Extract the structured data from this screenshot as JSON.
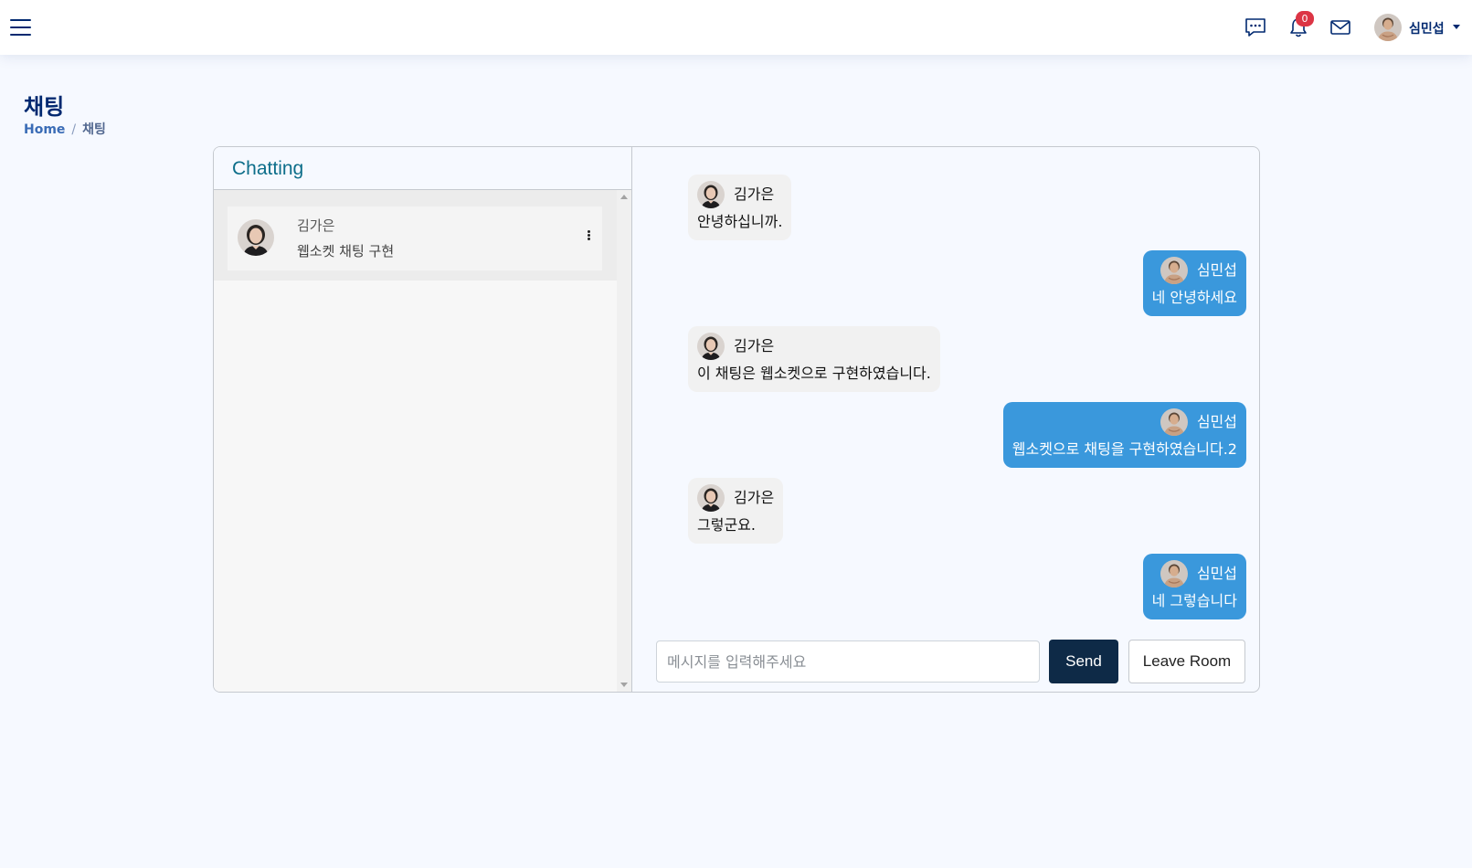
{
  "header": {
    "notification_count": "0",
    "user_name": "심민섭"
  },
  "page": {
    "title": "채팅",
    "breadcrumb": {
      "home": "Home",
      "separator": "/",
      "current": "채팅"
    }
  },
  "chat": {
    "panel_title": "Chatting",
    "rooms": [
      {
        "name": "김가은",
        "last_message": "웹소켓 채팅 구현"
      }
    ],
    "messages": [
      {
        "sender": "김가은",
        "text": "안녕하십니까.",
        "direction": "in"
      },
      {
        "sender": "심민섭",
        "text": "네 안녕하세요",
        "direction": "out"
      },
      {
        "sender": "김가은",
        "text": "이 채팅은 웹소켓으로 구현하였습니다.",
        "direction": "in"
      },
      {
        "sender": "심민섭",
        "text": "웹소켓으로 채팅을 구현하였습니다.2",
        "direction": "out"
      },
      {
        "sender": "김가은",
        "text": "그렇군요.",
        "direction": "in"
      },
      {
        "sender": "심민섭",
        "text": "네 그렇습니다",
        "direction": "out"
      }
    ],
    "input_placeholder": "메시지를 입력해주세요",
    "send_label": "Send",
    "leave_label": "Leave Room"
  },
  "colors": {
    "accent_navy": "#012970",
    "outgoing_bubble": "#3a98dc",
    "incoming_bubble": "#f1f1f1",
    "send_button": "#0e2a47",
    "badge": "#dc3545"
  },
  "icons": {
    "menu": "hamburger-icon",
    "chat": "chat-dots-icon",
    "notifications": "bell-icon",
    "mail": "envelope-icon",
    "room_menu": "kebab-icon"
  }
}
